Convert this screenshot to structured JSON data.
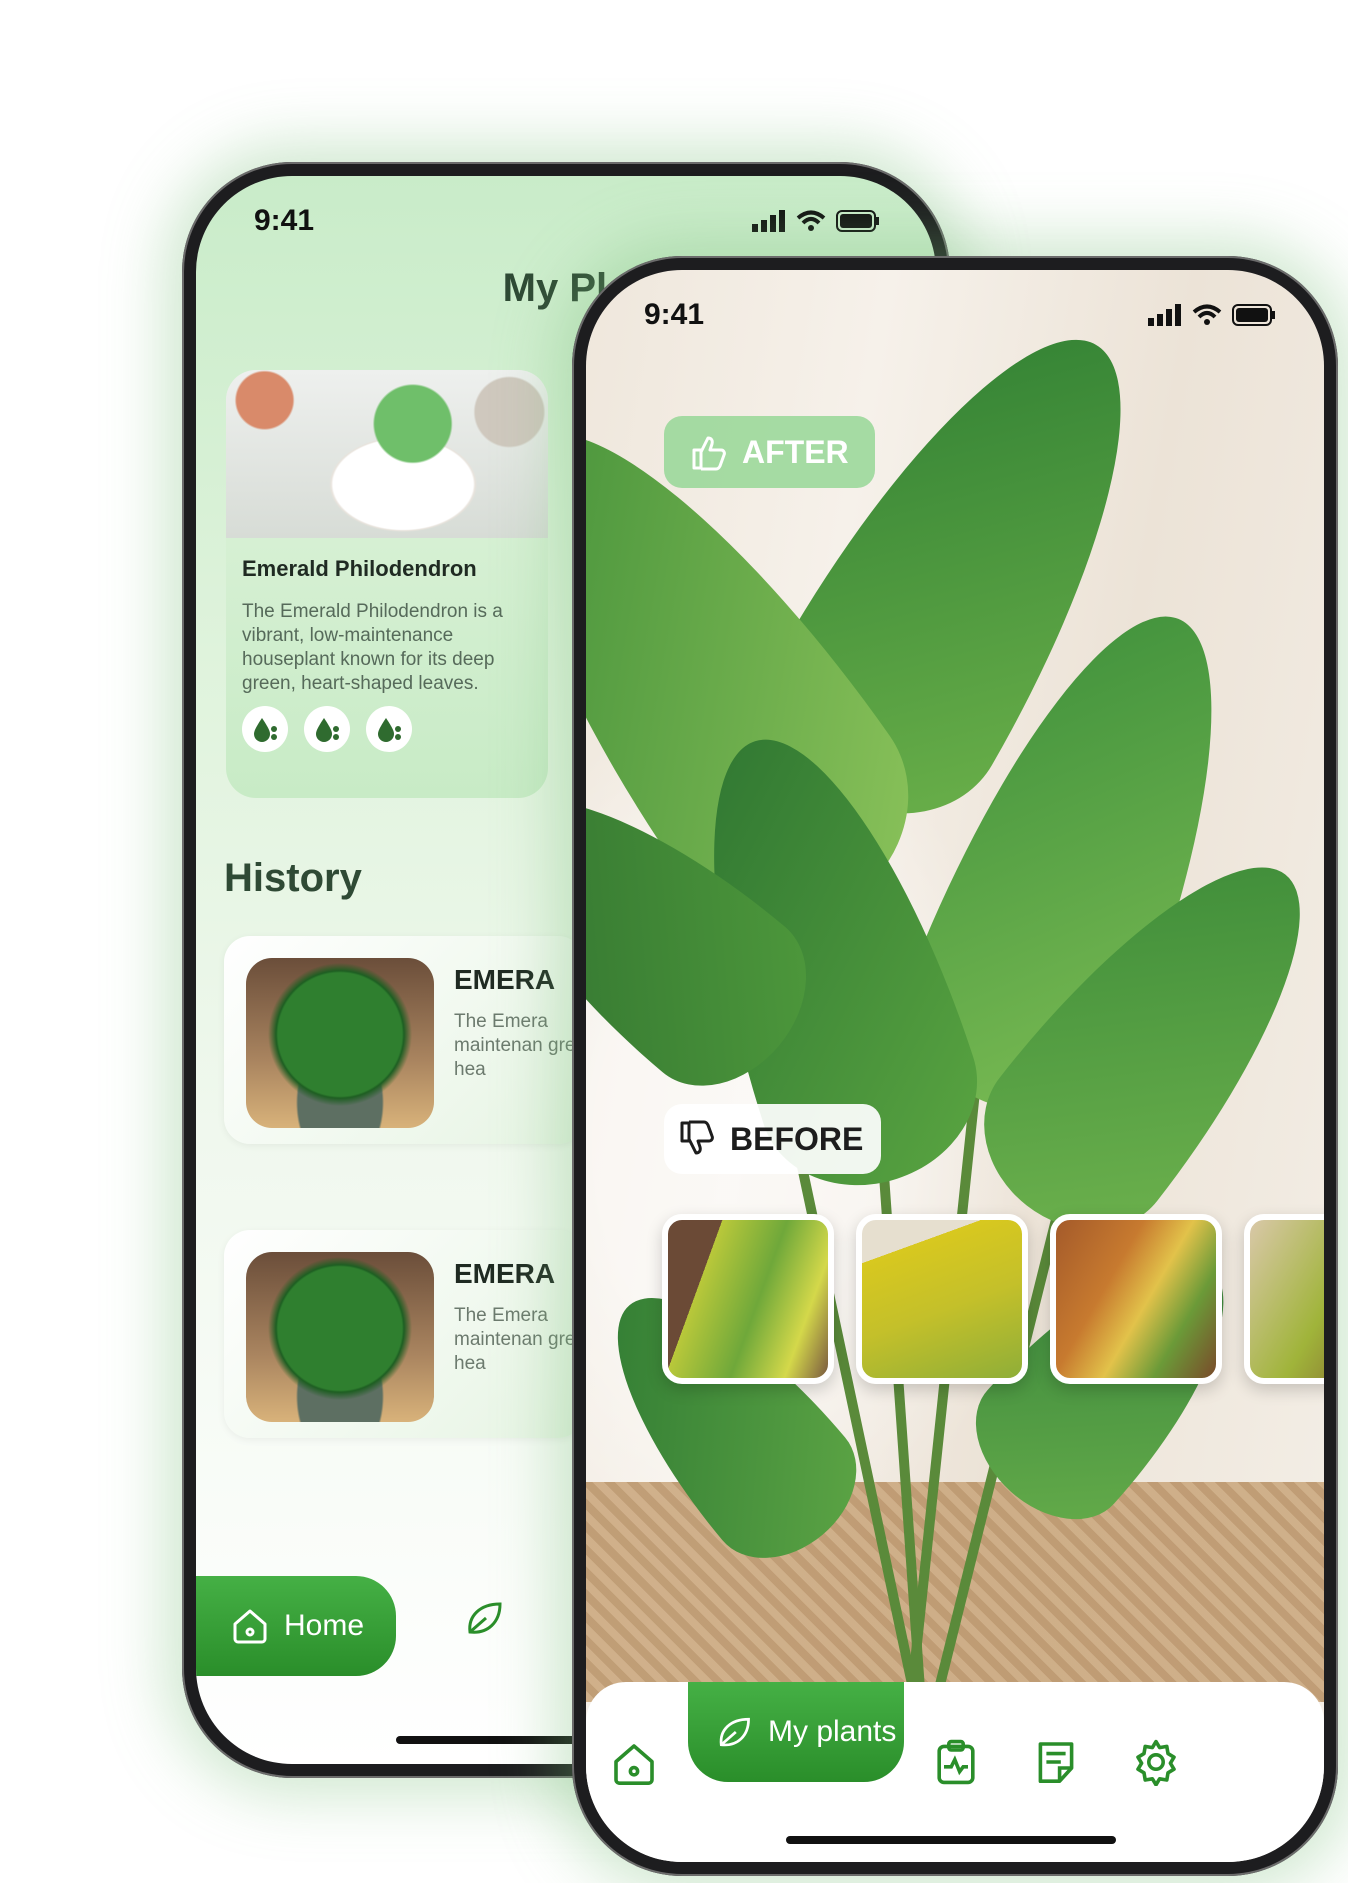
{
  "back_phone": {
    "status": {
      "time": "9:41"
    },
    "title": "My Pla",
    "featured_card": {
      "name": "Emerald Philodendron",
      "description": "The Emerald Philodendron is a vibrant, low-maintenance houseplant known for its deep green, heart-shaped leaves.",
      "care_icons": [
        "water-drop-icon",
        "water-drop-icon",
        "water-drop-icon"
      ]
    },
    "history": {
      "title": "History",
      "items": [
        {
          "title": "EMERA",
          "description": "The Emera maintenan green, hea"
        },
        {
          "title": "EMERA",
          "description": "The Emera maintenan green, hea"
        }
      ]
    },
    "tabbar": {
      "home_label": "Home"
    }
  },
  "front_phone": {
    "status": {
      "time": "9:41"
    },
    "after_label": "AFTER",
    "before_label": "BEFORE",
    "tabbar": {
      "my_plants_label": "My plants"
    }
  },
  "colors": {
    "accent_green": "#2a8e2a",
    "light_green": "#c9ecc9",
    "after_tag_bg": "#a6dea6"
  }
}
